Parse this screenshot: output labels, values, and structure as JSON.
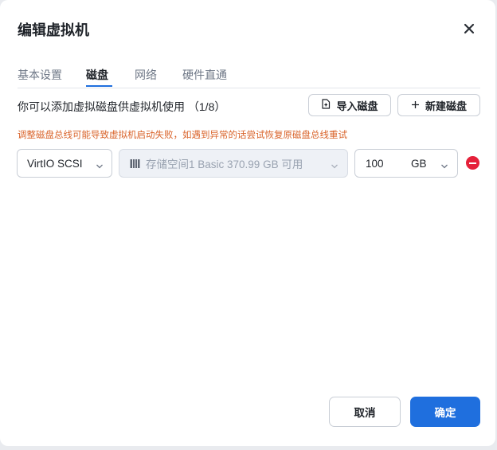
{
  "dialog": {
    "title": "编辑虚拟机",
    "close_icon": "close-icon"
  },
  "tabs": [
    {
      "label": "基本设置",
      "active": false
    },
    {
      "label": "磁盘",
      "active": true
    },
    {
      "label": "网络",
      "active": false
    },
    {
      "label": "硬件直通",
      "active": false
    }
  ],
  "disk": {
    "info_text": "你可以添加虚拟磁盘供虚拟机使用 （1/8）",
    "import_button": {
      "label": "导入磁盘",
      "icon": "file-import-icon"
    },
    "new_button": {
      "label": "新建磁盘",
      "icon": "plus-icon"
    },
    "warning": "调整磁盘总线可能导致虚拟机启动失败，如遇到异常的话尝试恢复原磁盘总线重试",
    "rows": [
      {
        "bus": "VirtIO SCSI",
        "storage": "存储空间1 Basic  370.99 GB 可用",
        "storage_icon": "storage-icon",
        "size": "100",
        "unit": "GB",
        "remove_icon": "remove-icon"
      }
    ]
  },
  "footer": {
    "cancel_label": "取消",
    "confirm_label": "确定"
  },
  "colors": {
    "primary": "#1f6fde",
    "warning": "#d9632a",
    "danger": "#e5213a"
  }
}
